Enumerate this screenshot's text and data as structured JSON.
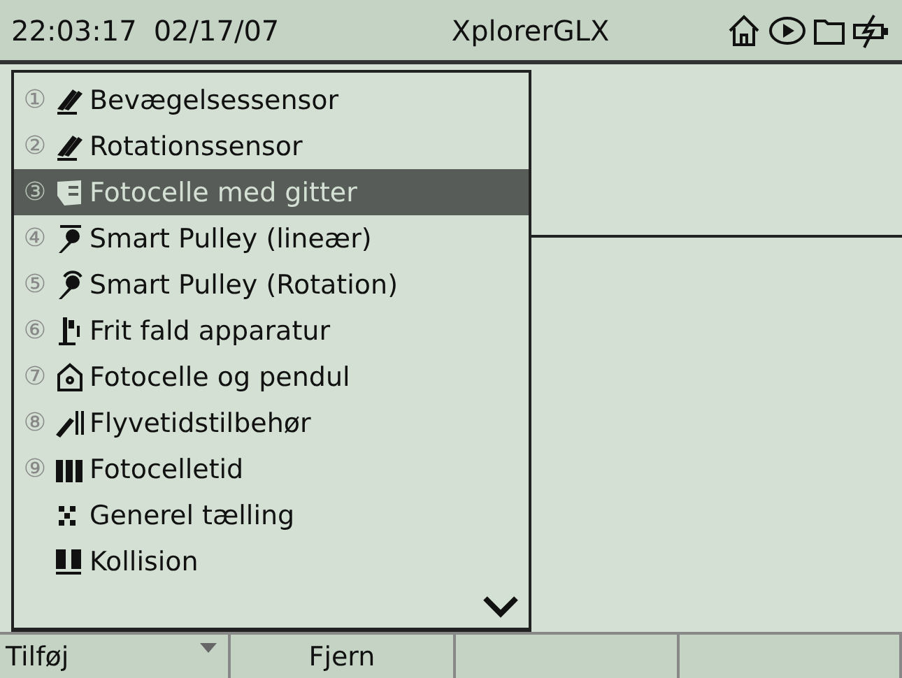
{
  "status_bar": {
    "time": "22:03:17",
    "date": "02/17/07",
    "title": "XplorerGLX"
  },
  "sensor_menu": {
    "items": [
      {
        "number": "①",
        "label": "Bevægelsessensor",
        "selected": false
      },
      {
        "number": "②",
        "label": "Rotationssensor",
        "selected": false
      },
      {
        "number": "③",
        "label": "Fotocelle med gitter",
        "selected": true
      },
      {
        "number": "④",
        "label": "Smart Pulley (lineær)",
        "selected": false
      },
      {
        "number": "⑤",
        "label": "Smart Pulley (Rotation)",
        "selected": false
      },
      {
        "number": "⑥",
        "label": "Frit fald apparatur",
        "selected": false
      },
      {
        "number": "⑦",
        "label": "Fotocelle og pendul",
        "selected": false
      },
      {
        "number": "⑧",
        "label": "Flyvetidstilbehør",
        "selected": false
      },
      {
        "number": "⑨",
        "label": "Fotocelletid",
        "selected": false
      },
      {
        "label": "Generel tælling",
        "selected": false
      },
      {
        "label": "Kollision",
        "selected": false
      }
    ]
  },
  "softkeys": [
    {
      "label": "Tilføj",
      "dropdown": true
    },
    {
      "label": "Fjern",
      "dropdown": false
    },
    {
      "dropdown": false
    },
    {
      "dropdown": false
    }
  ]
}
